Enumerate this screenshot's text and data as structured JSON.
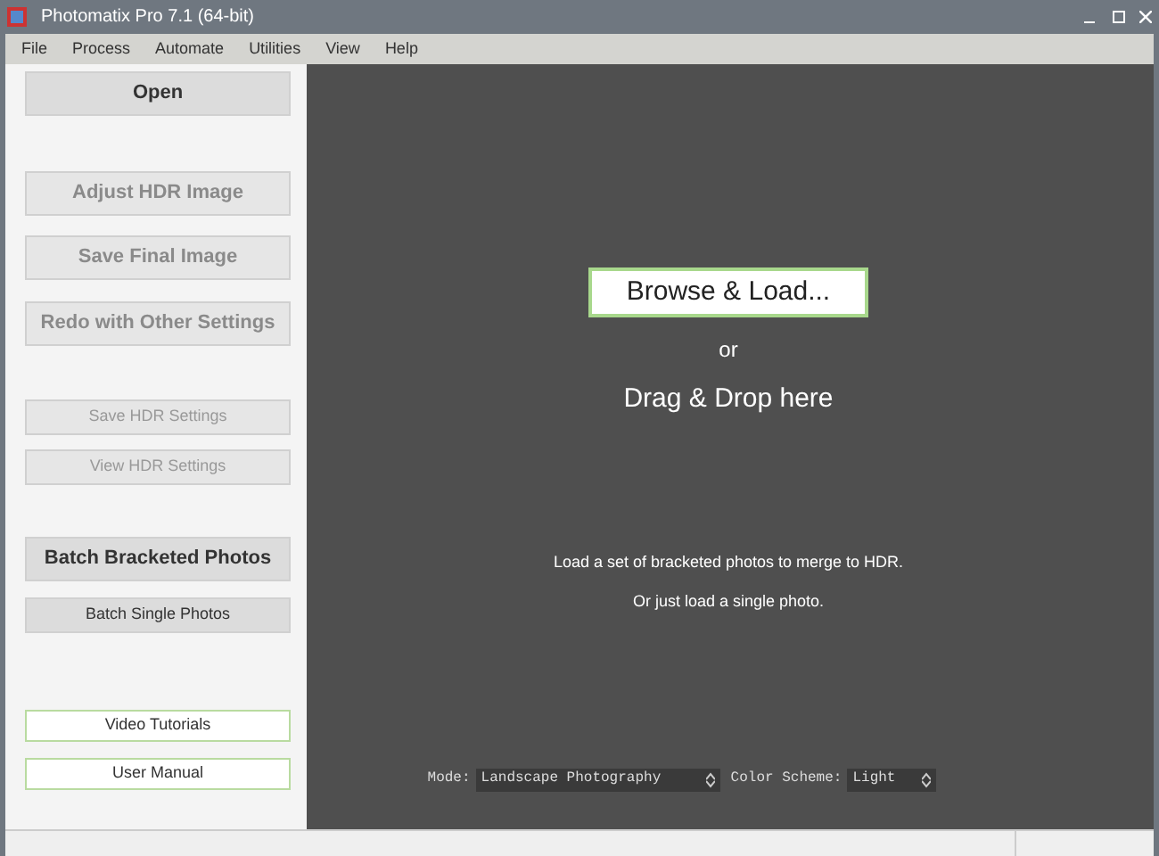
{
  "window": {
    "title": "Photomatix Pro 7.1 (64-bit)"
  },
  "menu": [
    "File",
    "Process",
    "Automate",
    "Utilities",
    "View",
    "Help"
  ],
  "sidebar": {
    "buttons": [
      {
        "label": "Open",
        "kind": "large",
        "disabled": false
      },
      {
        "label": "Adjust HDR Image",
        "kind": "large",
        "disabled": true
      },
      {
        "label": "Save Final Image",
        "kind": "large",
        "disabled": true
      },
      {
        "label": "Redo with Other Settings",
        "kind": "large",
        "disabled": true
      },
      {
        "label": "Save HDR Settings",
        "kind": "small",
        "disabled": true
      },
      {
        "label": "View HDR Settings",
        "kind": "small",
        "disabled": true
      },
      {
        "label": "Batch Bracketed Photos",
        "kind": "large",
        "disabled": false
      },
      {
        "label": "Batch Single Photos",
        "kind": "small",
        "disabled": false
      },
      {
        "label": "Video Tutorials",
        "kind": "link",
        "disabled": false
      },
      {
        "label": "User Manual",
        "kind": "link",
        "disabled": false
      }
    ]
  },
  "canvas": {
    "browse_button": "Browse & Load...",
    "or": "or",
    "drop_hint": "Drag & Drop here",
    "hints": [
      "Load a set of bracketed photos to merge to HDR.",
      "Or just load a single photo."
    ],
    "mode": {
      "label": "Mode:",
      "value": "Landscape Photography"
    },
    "color_scheme": {
      "label": "Color Scheme:",
      "value": "Light"
    }
  }
}
